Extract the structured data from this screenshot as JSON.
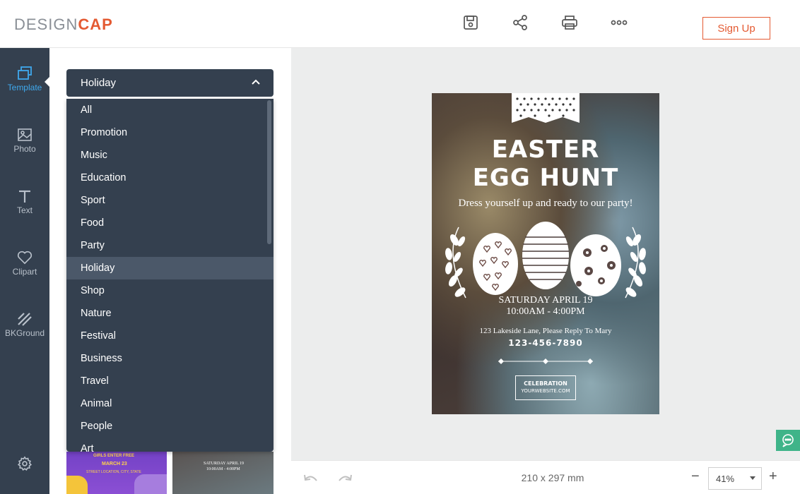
{
  "brand": {
    "part1": "DESIGN",
    "part2": "CAP",
    "accent": "#e45a32"
  },
  "toolbar": {
    "save_icon": "save-icon",
    "share_icon": "share-icon",
    "print_icon": "print-icon",
    "more_icon": "more-icon",
    "signup_label": "Sign Up"
  },
  "sidebar": {
    "items": [
      {
        "label": "Template",
        "icon": "template-icon"
      },
      {
        "label": "Photo",
        "icon": "photo-icon"
      },
      {
        "label": "Text",
        "icon": "text-icon"
      },
      {
        "label": "Clipart",
        "icon": "heart-icon"
      },
      {
        "label": "BKGround",
        "icon": "background-icon"
      }
    ],
    "settings_icon": "gear-icon"
  },
  "category": {
    "selected": "Holiday",
    "options": [
      "All",
      "Promotion",
      "Music",
      "Education",
      "Sport",
      "Food",
      "Party",
      "Holiday",
      "Shop",
      "Nature",
      "Festival",
      "Business",
      "Travel",
      "Animal",
      "People",
      "Art"
    ]
  },
  "thumbnails": {
    "t1": {
      "line1": "GIRLS ENTER FREE",
      "line2": "MARCH 23",
      "line3": "STREET LOCATION, CITY, STATE"
    },
    "t2": {
      "line1": "SATURDAY APRIL 19",
      "line2": "10:00AM - 4:00PM"
    }
  },
  "poster": {
    "title1": "EASTER",
    "title2": "EGG HUNT",
    "subtitle": "Dress yourself up and ready to our party!",
    "date": "SATURDAY APRIL 19",
    "time": "10:00AM - 4:00PM",
    "address": "123 Lakeside Lane, Please Reply To Mary",
    "phone": "123-456-7890",
    "box_line1": "CELEBRATION",
    "box_line2": "YOURWEBSITE.COM"
  },
  "footer": {
    "page_size": "210 x 297 mm",
    "zoom": "41%",
    "zoom_out": "−",
    "zoom_in": "+"
  }
}
